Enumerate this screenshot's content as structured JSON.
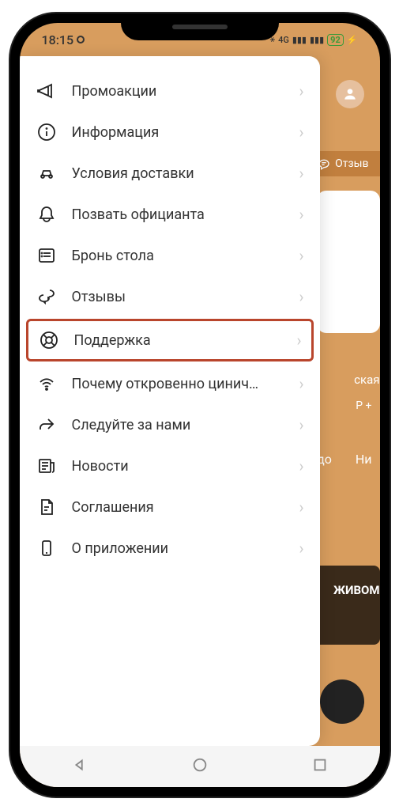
{
  "status": {
    "time": "18:15",
    "network_label": "4G",
    "battery_text": "92"
  },
  "background": {
    "reviews_button": "Отзыв",
    "text_line1": "ская",
    "text_line2": "Р +",
    "text_line3a": "до",
    "text_line3b": "Ни",
    "text_dark": "ЖИВОМ"
  },
  "drawer": {
    "items": [
      {
        "icon": "megaphone-icon",
        "label": "Промоакции",
        "highlighted": false
      },
      {
        "icon": "info-icon",
        "label": "Информация",
        "highlighted": false
      },
      {
        "icon": "car-icon",
        "label": "Условия доставки",
        "highlighted": false
      },
      {
        "icon": "bell-icon",
        "label": "Позвать официанта",
        "highlighted": false
      },
      {
        "icon": "list-icon",
        "label": "Бронь стола",
        "highlighted": false
      },
      {
        "icon": "chat-icon",
        "label": "Отзывы",
        "highlighted": false
      },
      {
        "icon": "lifebuoy-icon",
        "label": "Поддержка",
        "highlighted": true
      },
      {
        "icon": "wifi-icon",
        "label": "Почему откровенно цинич…",
        "highlighted": false
      },
      {
        "icon": "share-icon",
        "label": "Следуйте за нами",
        "highlighted": false
      },
      {
        "icon": "news-icon",
        "label": "Новости",
        "highlighted": false
      },
      {
        "icon": "document-icon",
        "label": "Соглашения",
        "highlighted": false
      },
      {
        "icon": "phone-icon",
        "label": "О приложении",
        "highlighted": false
      }
    ]
  }
}
